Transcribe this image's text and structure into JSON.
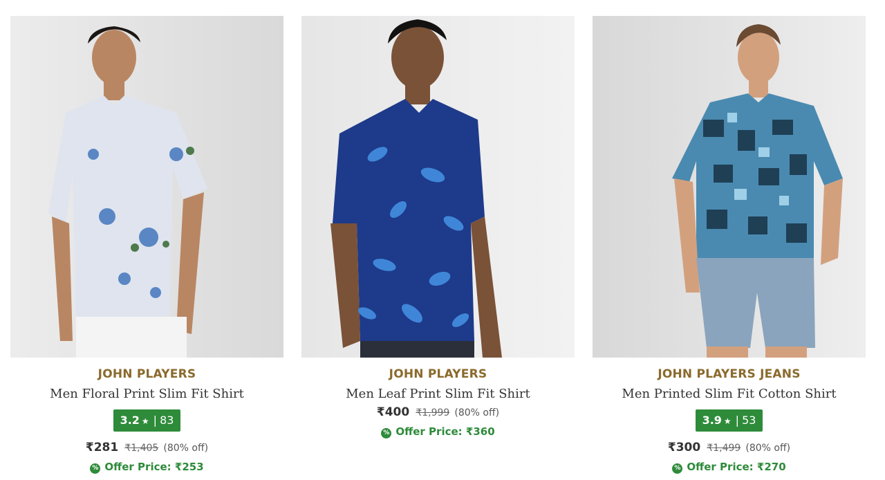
{
  "products": [
    {
      "brand": "JOHN PLAYERS",
      "name": "Men Floral Print Slim Fit Shirt",
      "rating": "3.2",
      "rating_count": "83",
      "price": "₹281",
      "mrp": "₹1,405",
      "discount": "(80% off)",
      "offer_label": "Offer Price:",
      "offer_price": "₹253",
      "shirt_color": "#dfe4ee",
      "print_color": "#5a86c4"
    },
    {
      "brand": "JOHN PLAYERS",
      "name": "Men Leaf Print Slim Fit Shirt",
      "rating": "",
      "rating_count": "",
      "price": "₹400",
      "mrp": "₹1,999",
      "discount": "(80% off)",
      "offer_label": "Offer Price:",
      "offer_price": "₹360",
      "shirt_color": "#1e3a8a",
      "print_color": "#3f86d8"
    },
    {
      "brand": "JOHN PLAYERS JEANS",
      "name": "Men Printed Slim Fit Cotton Shirt",
      "rating": "3.9",
      "rating_count": "53",
      "price": "₹300",
      "mrp": "₹1,499",
      "discount": "(80% off)",
      "offer_label": "Offer Price:",
      "offer_price": "₹270",
      "shirt_color": "#4a8ab0",
      "print_color": "#1f3f55"
    }
  ],
  "colors": {
    "brand": "#8a6a2c",
    "rating_bg": "#2e8b3a",
    "offer": "#2e8b3a"
  },
  "icons": {
    "rating": "star-icon",
    "offer": "percent-badge-icon"
  }
}
